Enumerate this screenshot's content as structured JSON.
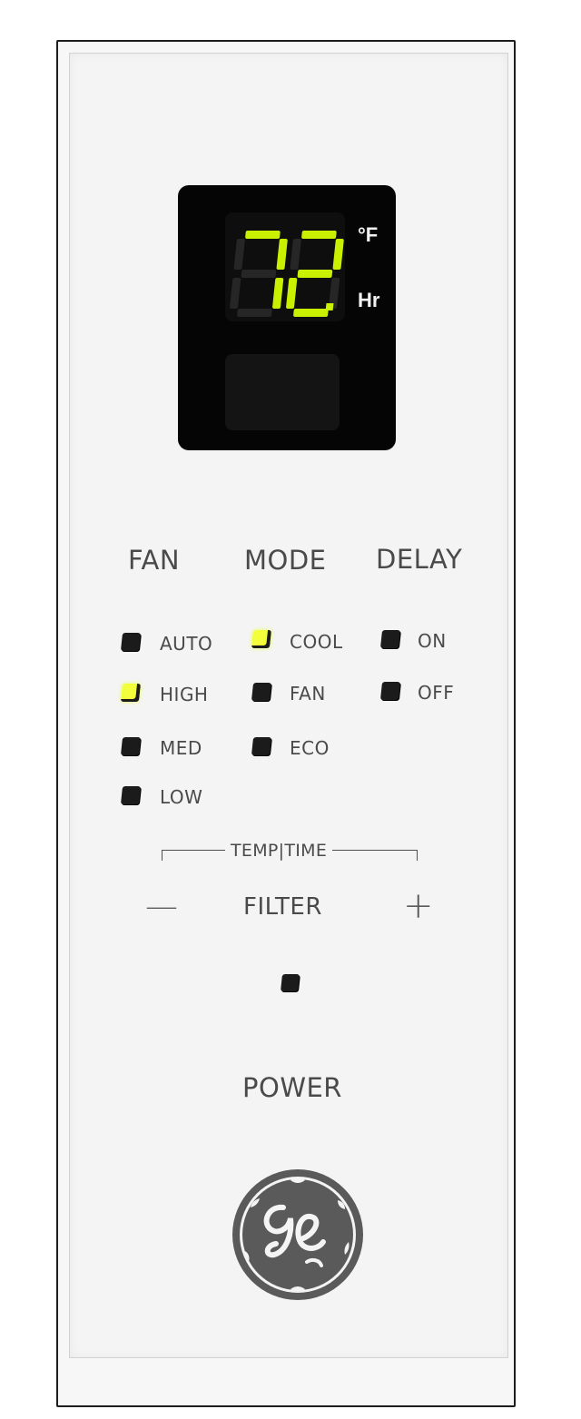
{
  "display": {
    "digits": "72",
    "unit_temp": "°F",
    "unit_time": "Hr"
  },
  "headers": {
    "fan": "FAN",
    "mode": "MODE",
    "delay": "DELAY"
  },
  "fan_options": [
    {
      "label": "AUTO",
      "lit": false
    },
    {
      "label": "HIGH",
      "lit": true
    },
    {
      "label": "MED",
      "lit": false
    },
    {
      "label": "LOW",
      "lit": false
    }
  ],
  "mode_options": [
    {
      "label": "COOL",
      "lit": true
    },
    {
      "label": "FAN",
      "lit": false
    },
    {
      "label": "ECO",
      "lit": false
    }
  ],
  "delay_options": [
    {
      "label": "ON",
      "lit": false
    },
    {
      "label": "OFF",
      "lit": false
    }
  ],
  "temp_time": {
    "label": "TEMP|TIME",
    "minus": "—",
    "plus": "+"
  },
  "filter": {
    "label": "FILTER"
  },
  "power": {
    "label": "POWER"
  },
  "brand": {
    "logo_text": "GE",
    "logo_icon": "ge-monogram-icon"
  },
  "colors": {
    "panel": "#f4f4f4",
    "display_bg": "#050505",
    "segment_on": "#c8f000",
    "segment_off": "#262626",
    "led_lit": "#f2ff3a",
    "led_off": "#1b1b1b",
    "text": "#4a4a4a",
    "logo": "#5a5a5a"
  }
}
